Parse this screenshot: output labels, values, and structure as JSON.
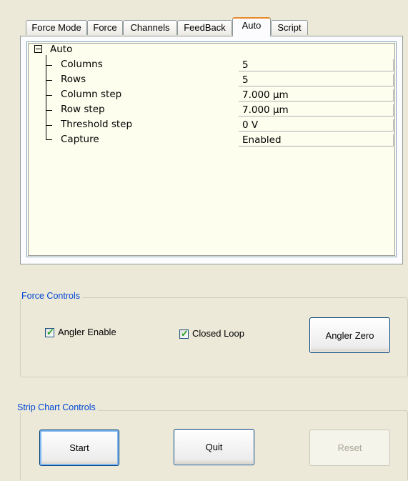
{
  "tabs": [
    {
      "label": "Force Mode"
    },
    {
      "label": "Force"
    },
    {
      "label": "Channels"
    },
    {
      "label": "FeedBack"
    },
    {
      "label": "Auto"
    },
    {
      "label": "Script"
    }
  ],
  "active_tab": "Auto",
  "property_grid": {
    "root": {
      "label": "Auto",
      "expanded": true
    },
    "rows": [
      {
        "label": "Columns",
        "value": "5"
      },
      {
        "label": "Rows",
        "value": "5"
      },
      {
        "label": "Column step",
        "value": "7.000 µm"
      },
      {
        "label": "Row step",
        "value": "7.000 µm"
      },
      {
        "label": "Threshold step",
        "value": "0 V"
      },
      {
        "label": "Capture",
        "value": "Enabled"
      }
    ]
  },
  "force_controls": {
    "legend": "Force Controls",
    "angler_enable": {
      "label": "Angler Enable",
      "checked": true
    },
    "closed_loop": {
      "label": "Closed Loop",
      "checked": true
    },
    "angler_zero_button": "Angler Zero"
  },
  "strip_chart_controls": {
    "legend": "Strip Chart Controls",
    "start_button": "Start",
    "quit_button": "Quit",
    "reset_button": "Reset",
    "reset_enabled": false
  }
}
